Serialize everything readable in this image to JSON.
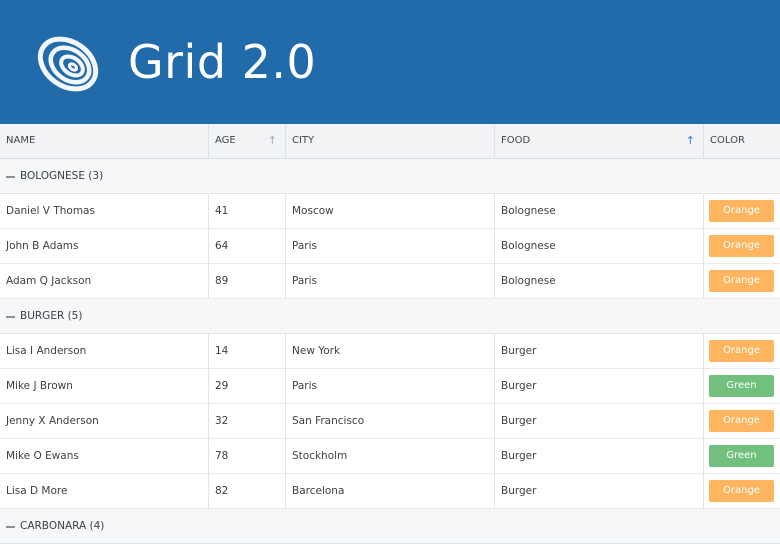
{
  "app": {
    "title": "Grid 2.0",
    "logo_icon": "spiral-logo-icon"
  },
  "colors": {
    "header_bg": "#226baa",
    "orange": "#fdb65f",
    "green": "#71c07e",
    "sort_active": "#2a7fd6"
  },
  "columns": [
    {
      "label": "NAME"
    },
    {
      "label": "AGE",
      "sort_icon": "sort-arrow-up-icon",
      "sort_state": "inactive"
    },
    {
      "label": "CITY"
    },
    {
      "label": "FOOD",
      "sort_icon": "sort-arrow-up-icon",
      "sort_state": "active-ascending"
    },
    {
      "label": "COLOR"
    }
  ],
  "groups": [
    {
      "label": "BOLOGNESE (3)",
      "rows": [
        {
          "name": "Daniel V Thomas",
          "age": "41",
          "city": "Moscow",
          "food": "Bolognese",
          "color": "Orange"
        },
        {
          "name": "John B Adams",
          "age": "64",
          "city": "Paris",
          "food": "Bolognese",
          "color": "Orange"
        },
        {
          "name": "Adam Q Jackson",
          "age": "89",
          "city": "Paris",
          "food": "Bolognese",
          "color": "Orange"
        }
      ]
    },
    {
      "label": "BURGER (5)",
      "rows": [
        {
          "name": "Lisa I Anderson",
          "age": "14",
          "city": "New York",
          "food": "Burger",
          "color": "Orange"
        },
        {
          "name": "Mike J Brown",
          "age": "29",
          "city": "Paris",
          "food": "Burger",
          "color": "Green"
        },
        {
          "name": "Jenny X Anderson",
          "age": "32",
          "city": "San Francisco",
          "food": "Burger",
          "color": "Orange"
        },
        {
          "name": "Mike O Ewans",
          "age": "78",
          "city": "Stockholm",
          "food": "Burger",
          "color": "Green"
        },
        {
          "name": "Lisa D More",
          "age": "82",
          "city": "Barcelona",
          "food": "Burger",
          "color": "Orange"
        }
      ]
    },
    {
      "label": "CARBONARA (4)",
      "rows": []
    }
  ]
}
